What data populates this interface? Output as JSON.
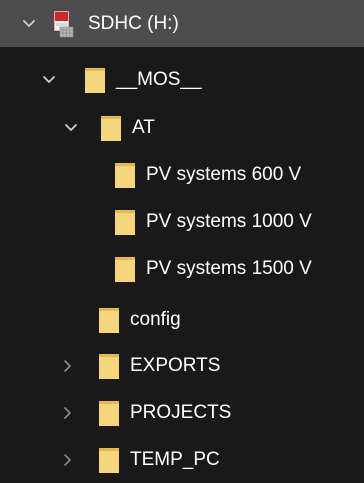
{
  "tree": {
    "drive": {
      "label": "SDHC (H:)",
      "icon": "sd-card-icon",
      "expanded": true
    },
    "items": [
      {
        "label": "__MOS__",
        "expanded": true,
        "has_children": true
      },
      {
        "label": "AT",
        "expanded": true,
        "has_children": true
      },
      {
        "label": "PV systems 600 V",
        "expanded": false,
        "has_children": false
      },
      {
        "label": "PV systems 1000 V",
        "expanded": false,
        "has_children": false
      },
      {
        "label": "PV systems 1500 V",
        "expanded": false,
        "has_children": false
      },
      {
        "label": "config",
        "expanded": false,
        "has_children": false
      },
      {
        "label": "EXPORTS",
        "expanded": false,
        "has_children": true
      },
      {
        "label": "PROJECTS",
        "expanded": false,
        "has_children": true
      },
      {
        "label": "TEMP_PC",
        "expanded": false,
        "has_children": true
      }
    ]
  },
  "colors": {
    "background": "#191919",
    "selected_row": "#4d4d4d",
    "folder": "#f5d67c",
    "folder_shadow": "#e2b84f",
    "text": "#ffffff",
    "chevron": "#cfcfcf",
    "chevron_collapsed": "#8c8c8c"
  }
}
